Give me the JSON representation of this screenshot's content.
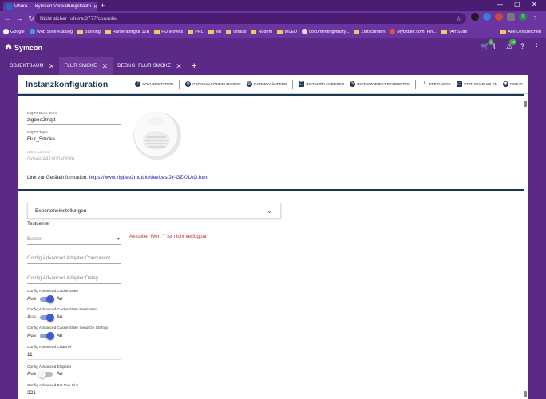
{
  "browser": {
    "tab_title": "Uhura — Symcon Verwaltungsfläche",
    "security_label": "Nicht sicher",
    "url": "uhura:3777/console/",
    "bookmarks": [
      "Google",
      "Web Slice-Katalog",
      "Banking",
      "Hardenbergstr 12B",
      "HD Movies",
      "PPL",
      "feh",
      "Urlaub",
      "Rudem",
      "WLED",
      "documentingreality...",
      "Zeitschriften",
      "Mybidder.com: Fin...",
      "*Arr Suite"
    ],
    "bookmarks_right": "Alle Lesezeichen",
    "profile_initial": "T"
  },
  "app": {
    "name": "Symcon",
    "badges": {
      "cart": "1",
      "notifications": "18"
    }
  },
  "tabs": [
    {
      "label": "OBJEKTBAUM"
    },
    {
      "label": "FLUR SMOKE"
    },
    {
      "label": "DEBUG: FLUR SMOKE"
    }
  ],
  "panel": {
    "title": "Instanzkonfiguration",
    "toolbar": [
      "DOKUMENTATION",
      "GATEWAY KONFIGURIEREN",
      "GATEWAY ÄNDERN",
      "INSTANZID KOPIEREN",
      "INSTANZOBJEKT BEARBEITEN",
      "EREIGNISSE",
      "STATUSVARIABLEN",
      "DEBUG"
    ]
  },
  "form": {
    "base_topic_label": "MQTT Base Topic",
    "base_topic_value": "zigbee2mqtt",
    "topic_label": "MQTT Topic",
    "topic_value": "Flur_Smoke",
    "ieee_label": "IEEE Adresse",
    "ieee_value": "0x54ef441000af39f6",
    "link_prefix": "Link zur Geräteinformation:",
    "link_url": "https://www.zigbee2mqtt.io/devices/JY-GZ-01AQ.html",
    "expander_label": "Experteneinstellungen",
    "testcenter_label": "Testcenter",
    "buzzer_placeholder": "Buzzer",
    "buzzer_error": "Aktueller Wert \"\" ist nicht verfügbar",
    "concurrent_placeholder": "Config Advanced Adapter Concurrent",
    "delay_placeholder": "Config Advanced Adapter Delay",
    "cache_state_label": "Config Advanced Cache State",
    "cache_persistent_label": "Config Advanced Cache State Persistent",
    "cache_startup_label": "Config Advanced Cache State Send On Startup",
    "off_label": "Aus",
    "on_label": "An",
    "channel_label": "Config Advanced Channel",
    "channel_value": "11",
    "elapsed_label": "Config Advanced Elapsed",
    "ext_pan_label": "Config Advanced Ext Pan Id 0",
    "ext_pan_value": "221"
  },
  "toggles": {
    "cache_state": 1,
    "cache_persistent": 1,
    "cache_startup": 1,
    "elapsed": 0
  }
}
